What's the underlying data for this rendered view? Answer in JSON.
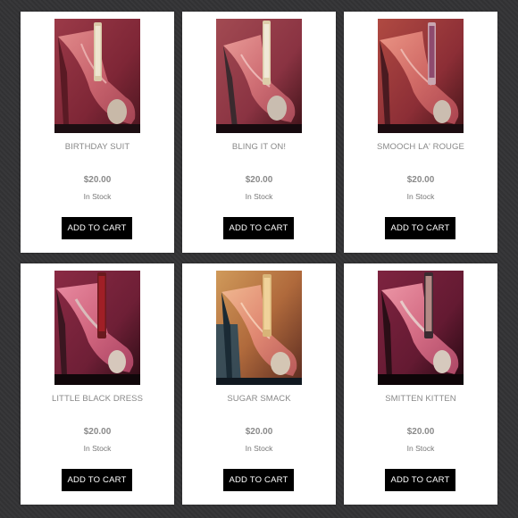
{
  "products": [
    {
      "name": "BIRTHDAY SUIT",
      "price": "$20.00",
      "stock": "In Stock",
      "button": "ADD TO CART",
      "image": "pink-glitter-heel-with-lip-gloss"
    },
    {
      "name": "BLING IT ON!",
      "price": "$20.00",
      "stock": "In Stock",
      "button": "ADD TO CART",
      "image": "pink-glitter-heel-with-lip-gloss"
    },
    {
      "name": "SMOOCH LA' ROUGE",
      "price": "$20.00",
      "stock": "In Stock",
      "button": "ADD TO CART",
      "image": "pink-glitter-heel-with-lip-gloss"
    },
    {
      "name": "LITTLE BLACK DRESS",
      "price": "$20.00",
      "stock": "In Stock",
      "button": "ADD TO CART",
      "image": "pink-glitter-heel-with-lip-gloss"
    },
    {
      "name": "SUGAR SMACK",
      "price": "$20.00",
      "stock": "In Stock",
      "button": "ADD TO CART",
      "image": "pink-glitter-heel-with-lip-gloss"
    },
    {
      "name": "SMITTEN KITTEN",
      "price": "$20.00",
      "stock": "In Stock",
      "button": "ADD TO CART",
      "image": "pink-glitter-heel-with-lip-gloss"
    }
  ],
  "colors": {
    "page_background": "#333335",
    "card_background": "#ffffff",
    "button_background": "#000000",
    "button_text": "#ffffff",
    "text_muted": "#888888"
  }
}
